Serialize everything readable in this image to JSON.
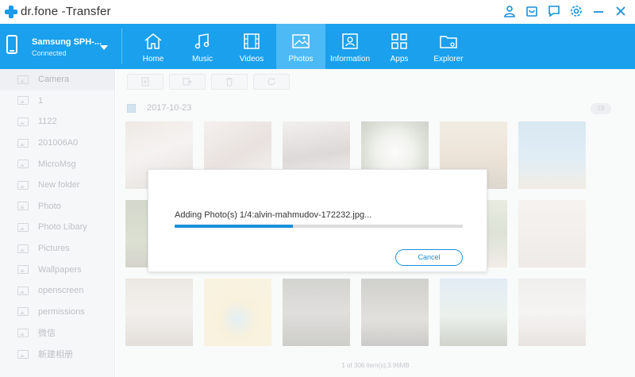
{
  "app": {
    "logo_text": "dr.fone -Transfer"
  },
  "window_controls": [
    {
      "name": "user-icon"
    },
    {
      "name": "store-icon"
    },
    {
      "name": "feedback-icon"
    },
    {
      "name": "settings-icon"
    },
    {
      "name": "minimize-icon"
    },
    {
      "name": "close-icon"
    }
  ],
  "device": {
    "name": "Samsung SPH-...",
    "status": "Connected"
  },
  "tabs": [
    {
      "label": "Home",
      "icon": "home-icon"
    },
    {
      "label": "Music",
      "icon": "music-icon"
    },
    {
      "label": "Videos",
      "icon": "video-icon"
    },
    {
      "label": "Photos",
      "icon": "photo-icon",
      "active": true
    },
    {
      "label": "Information",
      "icon": "contact-icon"
    },
    {
      "label": "Apps",
      "icon": "apps-icon"
    },
    {
      "label": "Explorer",
      "icon": "folder-icon"
    }
  ],
  "sidebar": {
    "items": [
      {
        "label": "Camera",
        "active": true
      },
      {
        "label": "1"
      },
      {
        "label": "1122"
      },
      {
        "label": "201006A0"
      },
      {
        "label": "MicroMsg"
      },
      {
        "label": "New folder"
      },
      {
        "label": "Photo"
      },
      {
        "label": "Photo Libary"
      },
      {
        "label": "Pictures"
      },
      {
        "label": "Wallpapers"
      },
      {
        "label": "openscreen"
      },
      {
        "label": "permissions"
      },
      {
        "label": "微信"
      },
      {
        "label": "新建相册"
      }
    ]
  },
  "content": {
    "date_label": "2017-10-23",
    "date_count": "18",
    "footer": "1 of 306 item(s),3.96MB"
  },
  "modal": {
    "message": "Adding Photo(s) 1/4:alvin-mahmudov-172232.jpg...",
    "progress": 0.41,
    "cancel_label": "Cancel"
  },
  "colors": {
    "accent": "#1aa0ec",
    "active_tab": "#4dbaf5",
    "button_blue": "#1a8fd8"
  }
}
